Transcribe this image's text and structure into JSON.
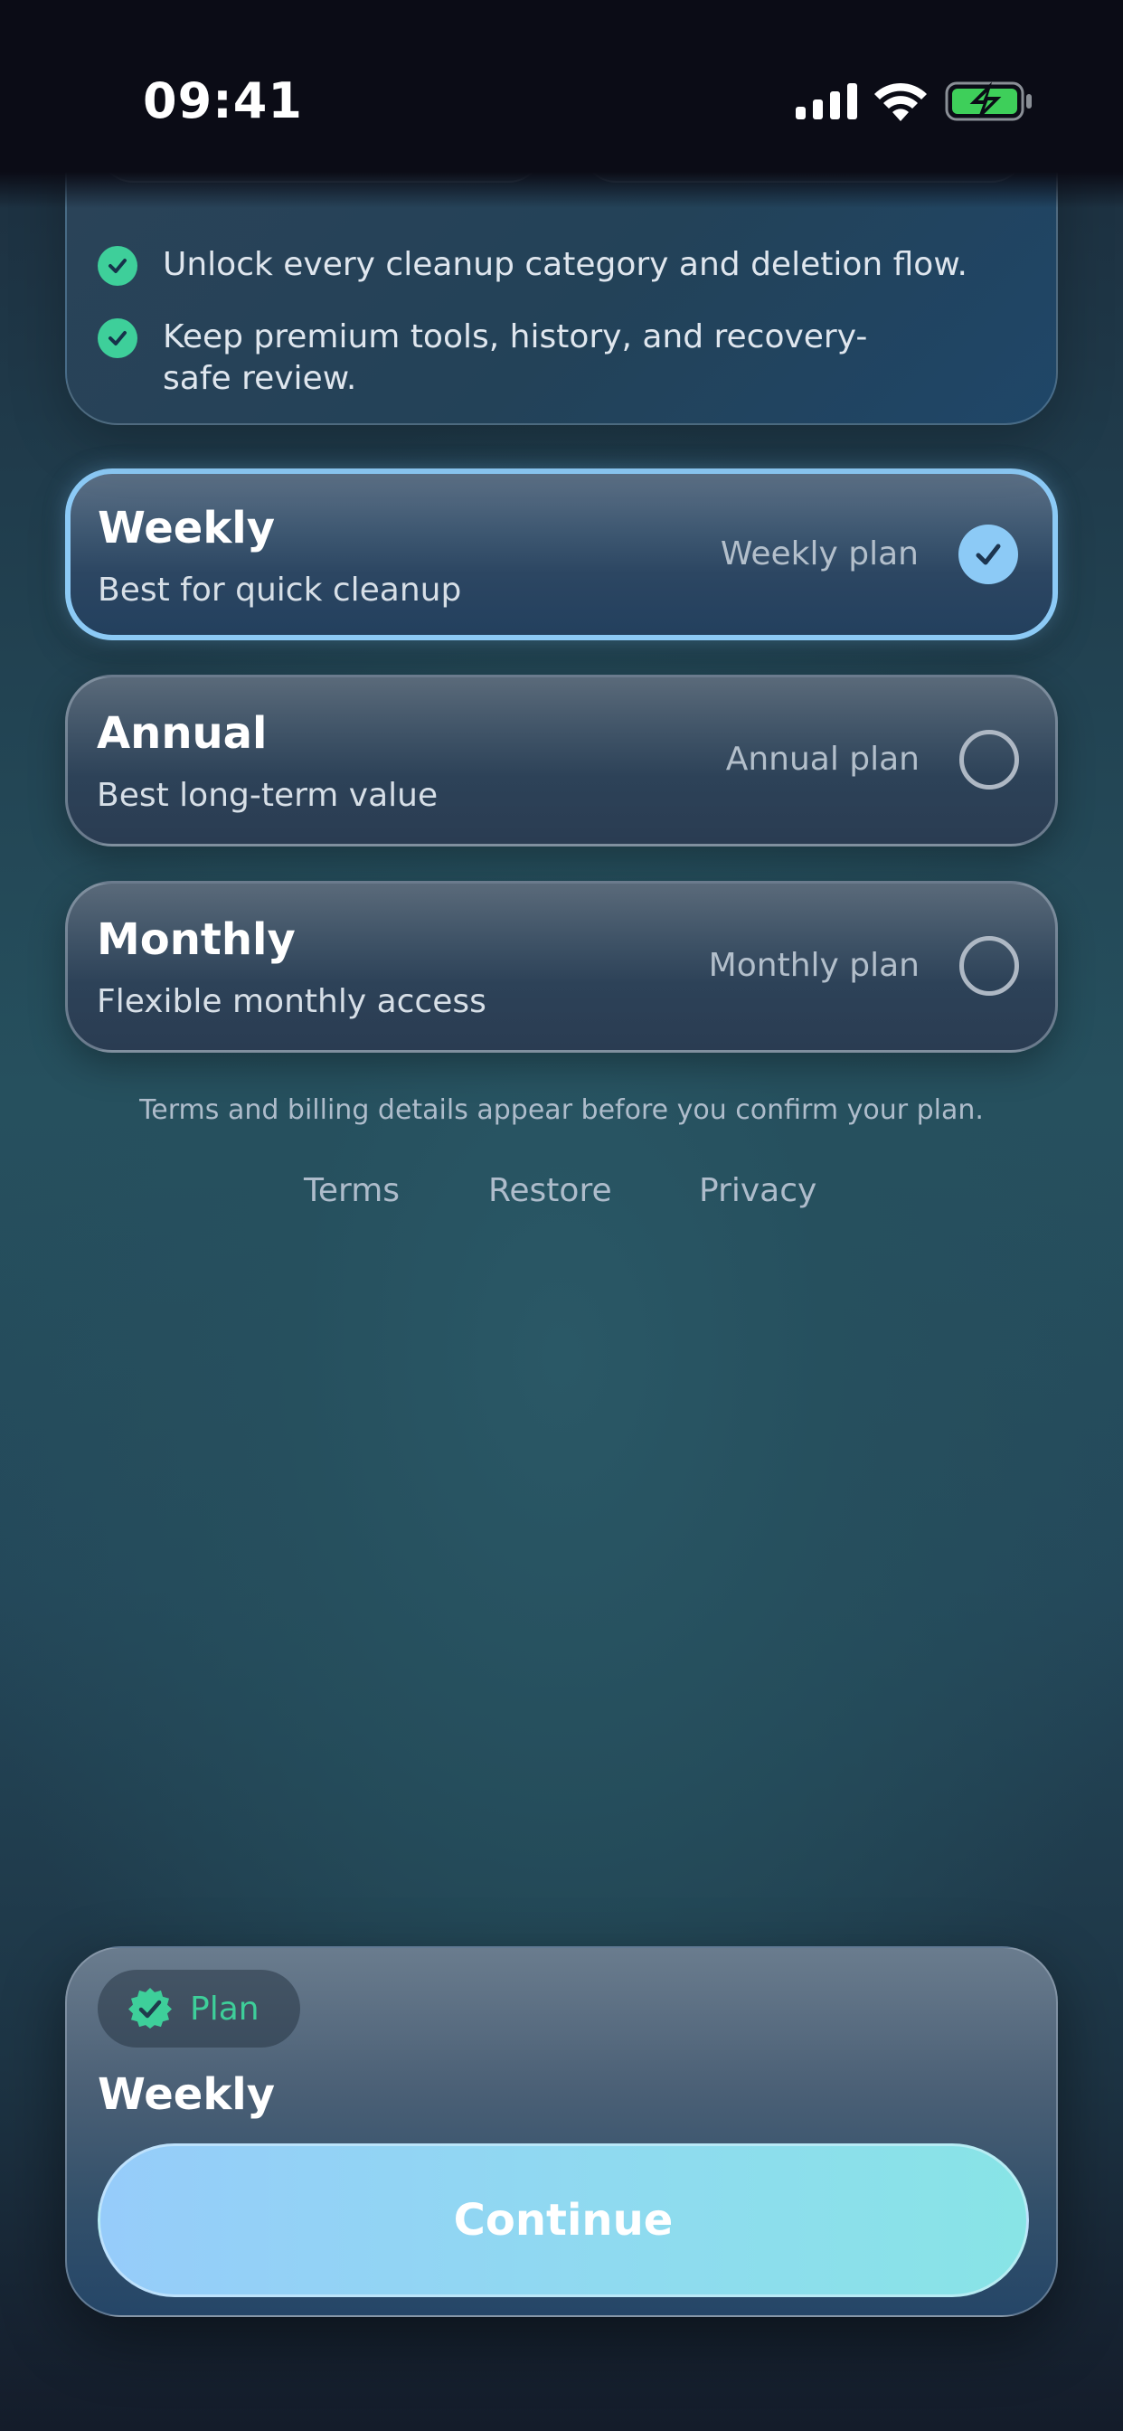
{
  "status_bar": {
    "time": "09:41",
    "icons": [
      "signal-icon",
      "wifi-icon",
      "battery-charging-icon"
    ],
    "battery_color": "#3ecf5a"
  },
  "features": {
    "items": [
      "Unlock every cleanup category and deletion flow.",
      "Keep premium tools, history, and recovery-safe review."
    ]
  },
  "plans": [
    {
      "id": "weekly",
      "title": "Weekly",
      "subtitle": "Best for quick cleanup",
      "label": "Weekly plan",
      "selected": true
    },
    {
      "id": "annual",
      "title": "Annual",
      "subtitle": "Best long-term value",
      "label": "Annual plan",
      "selected": false
    },
    {
      "id": "monthly",
      "title": "Monthly",
      "subtitle": "Flexible monthly access",
      "label": "Monthly plan",
      "selected": false
    }
  ],
  "terms_note": "Terms and billing details appear before you confirm your plan.",
  "links": {
    "terms": "Terms",
    "restore": "Restore",
    "privacy": "Privacy"
  },
  "summary": {
    "chip_label": "Plan",
    "plan_name": "Weekly",
    "continue_label": "Continue"
  },
  "colors": {
    "accent": "#8ccaf6",
    "success": "#3ecf9a",
    "button_start": "#96ccfa",
    "button_end": "#88e4e6"
  }
}
